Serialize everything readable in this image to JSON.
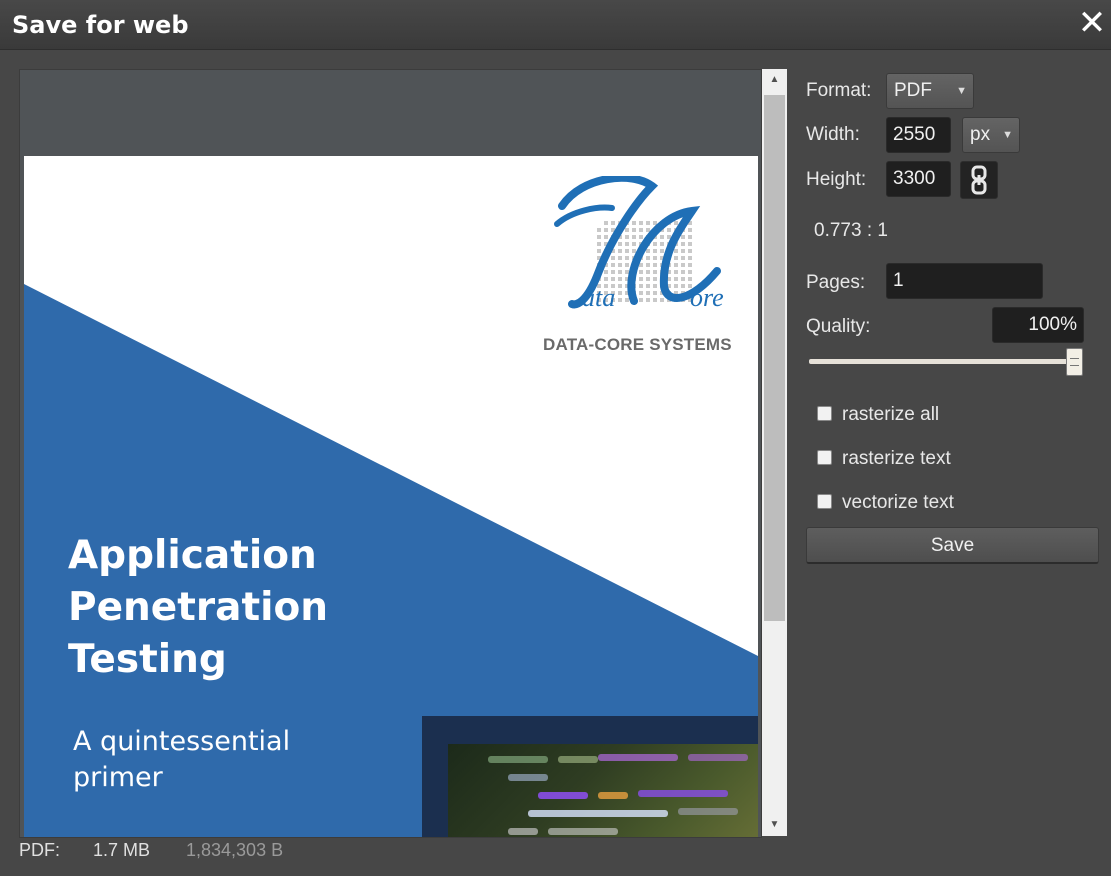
{
  "dialog": {
    "title": "Save for web",
    "close_glyph": "✕"
  },
  "preview": {
    "document": {
      "logo_text": "DATA-CORE SYSTEMS",
      "title_lines": [
        "Application",
        "Penetration",
        "Testing"
      ],
      "subtitle_lines": [
        "A quintessential",
        "primer"
      ],
      "colors": {
        "blue": "#2f6aab",
        "logo_blue": "#1f6fb6",
        "white": "#ffffff"
      }
    }
  },
  "status": {
    "format": "PDF:",
    "size": "1.7 MB",
    "bytes": "1,834,303 B"
  },
  "options": {
    "format_label": "Format:",
    "format_value": "PDF",
    "width_label": "Width:",
    "width_value": "2550",
    "unit_value": "px",
    "height_label": "Height:",
    "height_value": "3300",
    "link_icon": "link-chain-icon",
    "ratio": "0.773 : 1",
    "pages_label": "Pages:",
    "pages_value": "1",
    "quality_label": "Quality:",
    "quality_value": "100%",
    "quality_level": 1.0,
    "checkboxes": [
      {
        "label": "rasterize all",
        "checked": false
      },
      {
        "label": "rasterize text",
        "checked": false
      },
      {
        "label": "vectorize text",
        "checked": false
      }
    ],
    "save_label": "Save"
  }
}
